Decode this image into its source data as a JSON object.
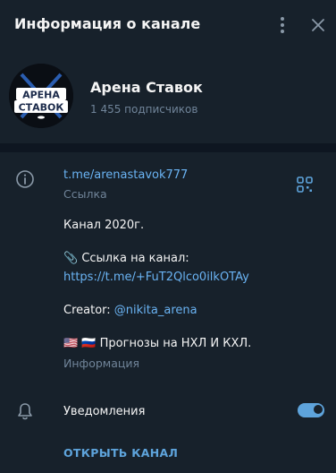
{
  "header": {
    "title": "Информация о канале"
  },
  "profile": {
    "channel_name": "Арена Ставок",
    "subscribers": "1 455 подписчиков",
    "avatar_text_line1": "АРЕНА",
    "avatar_text_line2": "СТАВОК"
  },
  "info": {
    "link": "t.me/arenastavok777",
    "link_caption": "Ссылка",
    "description_line1": "Канал 2020г.",
    "description_line2": "📎 Ссылка на канал:",
    "invite_link": "https://t.me/+FuT2Qlco0ilkOTAy",
    "creator_prefix": "Creator:",
    "creator_handle": "@nikita_arena",
    "description_line3": "🇺🇸 🇷🇺 Прогнозы на НХЛ И КХЛ.",
    "description_caption": "Информация"
  },
  "notifications": {
    "label": "Уведомления",
    "enabled": true
  },
  "actions": {
    "open_channel": "ОТКРЫТЬ КАНАЛ"
  },
  "colors": {
    "background": "#17212b",
    "separator": "#0e1621",
    "link": "#6ab3f3",
    "muted": "#708499",
    "accent": "#5ea4dc"
  },
  "icons": [
    "more-vertical-icon",
    "close-icon",
    "info-icon",
    "qr-code-icon",
    "bell-icon"
  ]
}
